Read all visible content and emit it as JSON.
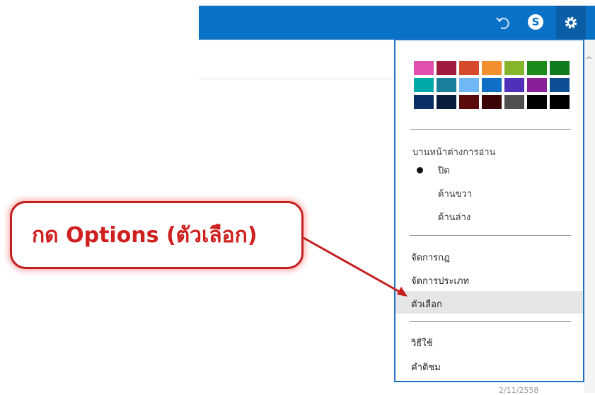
{
  "toolbar": {
    "skype_letter": "S"
  },
  "colors": {
    "accent": "#0a72c6",
    "callout_red": "#d01f1f"
  },
  "theme_swatches": [
    "#e04fae",
    "#a01c3e",
    "#d54a2a",
    "#f28f2e",
    "#86b42a",
    "#1a8a1a",
    "#0f7d1f",
    "#00a8a8",
    "#1a7f9a",
    "#6fb7f5",
    "#0e6fc4",
    "#5030b8",
    "#8a1f9a",
    "#0c4f95",
    "#0a2f64",
    "#0b1d3c",
    "#5a0a0a",
    "#3c0404",
    "#505050",
    "#000000",
    "#000000"
  ],
  "menu": {
    "reading_pane_heading": "บานหน้าต่างการอ่าน",
    "reading_options": [
      "ปิด",
      "ด้านขวา",
      "ด้านล่าง"
    ],
    "manage_rules": "จัดการกฎ",
    "manage_categories": "จัดการประเภท",
    "options": "ตัวเลือก",
    "help": "วิธีใช้",
    "feedback": "คำติชม"
  },
  "annotation": {
    "callout_text": "กด Options (ตัวเลือก)"
  },
  "footer": {
    "partial_text": "2/11/2558"
  }
}
